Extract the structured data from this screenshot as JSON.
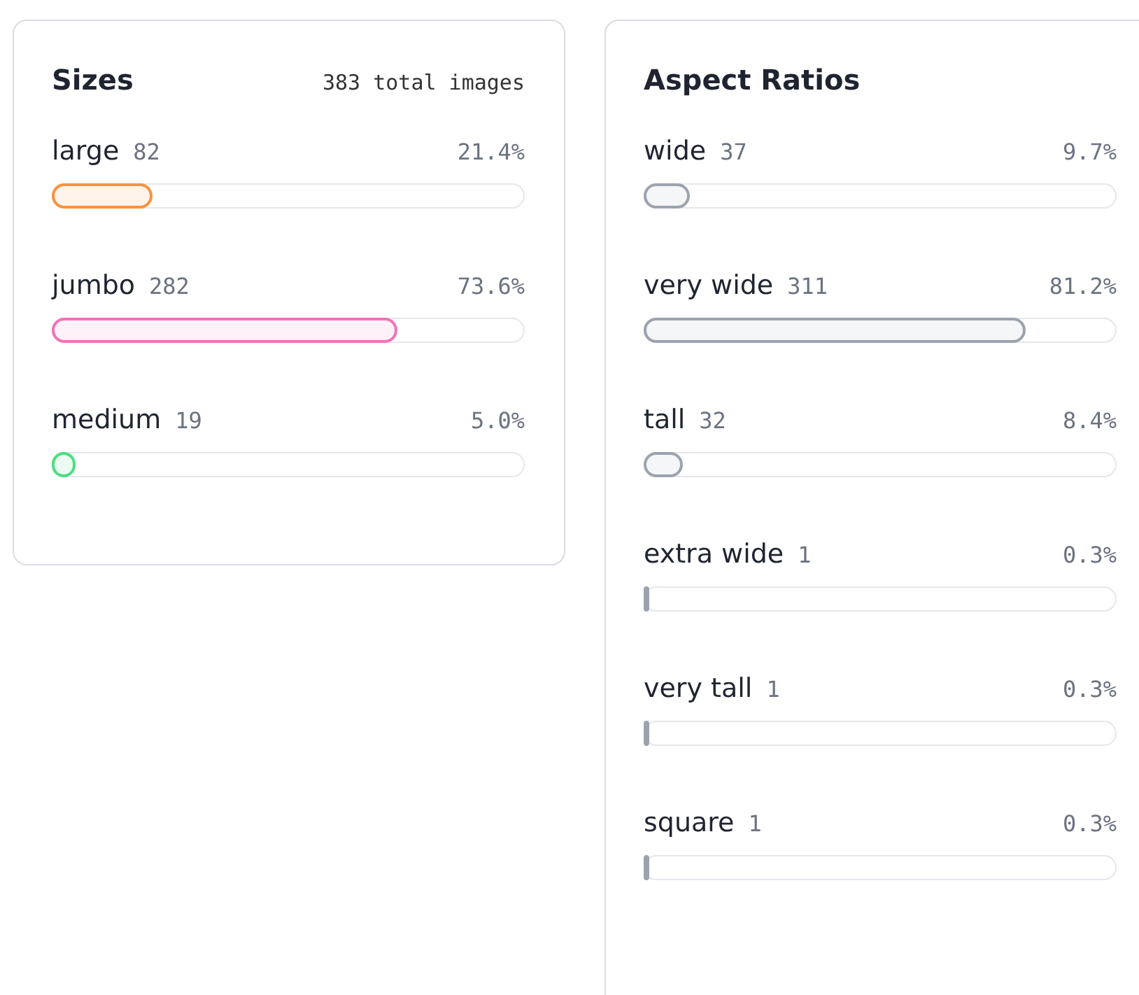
{
  "cards": [
    {
      "title": "Sizes",
      "subtitle": "383 total images",
      "items": [
        {
          "label": "large",
          "count": "82",
          "percent": "21.4%",
          "level": 0.214,
          "color": "#fb923c"
        },
        {
          "label": "jumbo",
          "count": "282",
          "percent": "73.6%",
          "level": 0.736,
          "color": "#f472b6"
        },
        {
          "label": "medium",
          "count": "19",
          "percent": "5.0%",
          "level": 0.05,
          "color": "#4ade80"
        }
      ]
    },
    {
      "title": "Aspect Ratios",
      "items": [
        {
          "label": "wide",
          "count": "37",
          "percent": "9.7%",
          "level": 0.097,
          "color": "#9ca3af"
        },
        {
          "label": "very wide",
          "count": "311",
          "percent": "81.2%",
          "level": 0.812,
          "color": "#9ca3af"
        },
        {
          "label": "tall",
          "count": "32",
          "percent": "8.4%",
          "level": 0.084,
          "color": "#9ca3af"
        },
        {
          "label": "extra wide",
          "count": "1",
          "percent": "0.3%",
          "level": 0.003,
          "color": "#9ca3af"
        },
        {
          "label": "very tall",
          "count": "1",
          "percent": "0.3%",
          "level": 0.003,
          "color": "#9ca3af"
        },
        {
          "label": "square",
          "count": "1",
          "percent": "0.3%",
          "level": 0.003,
          "color": "#9ca3af"
        }
      ]
    }
  ]
}
